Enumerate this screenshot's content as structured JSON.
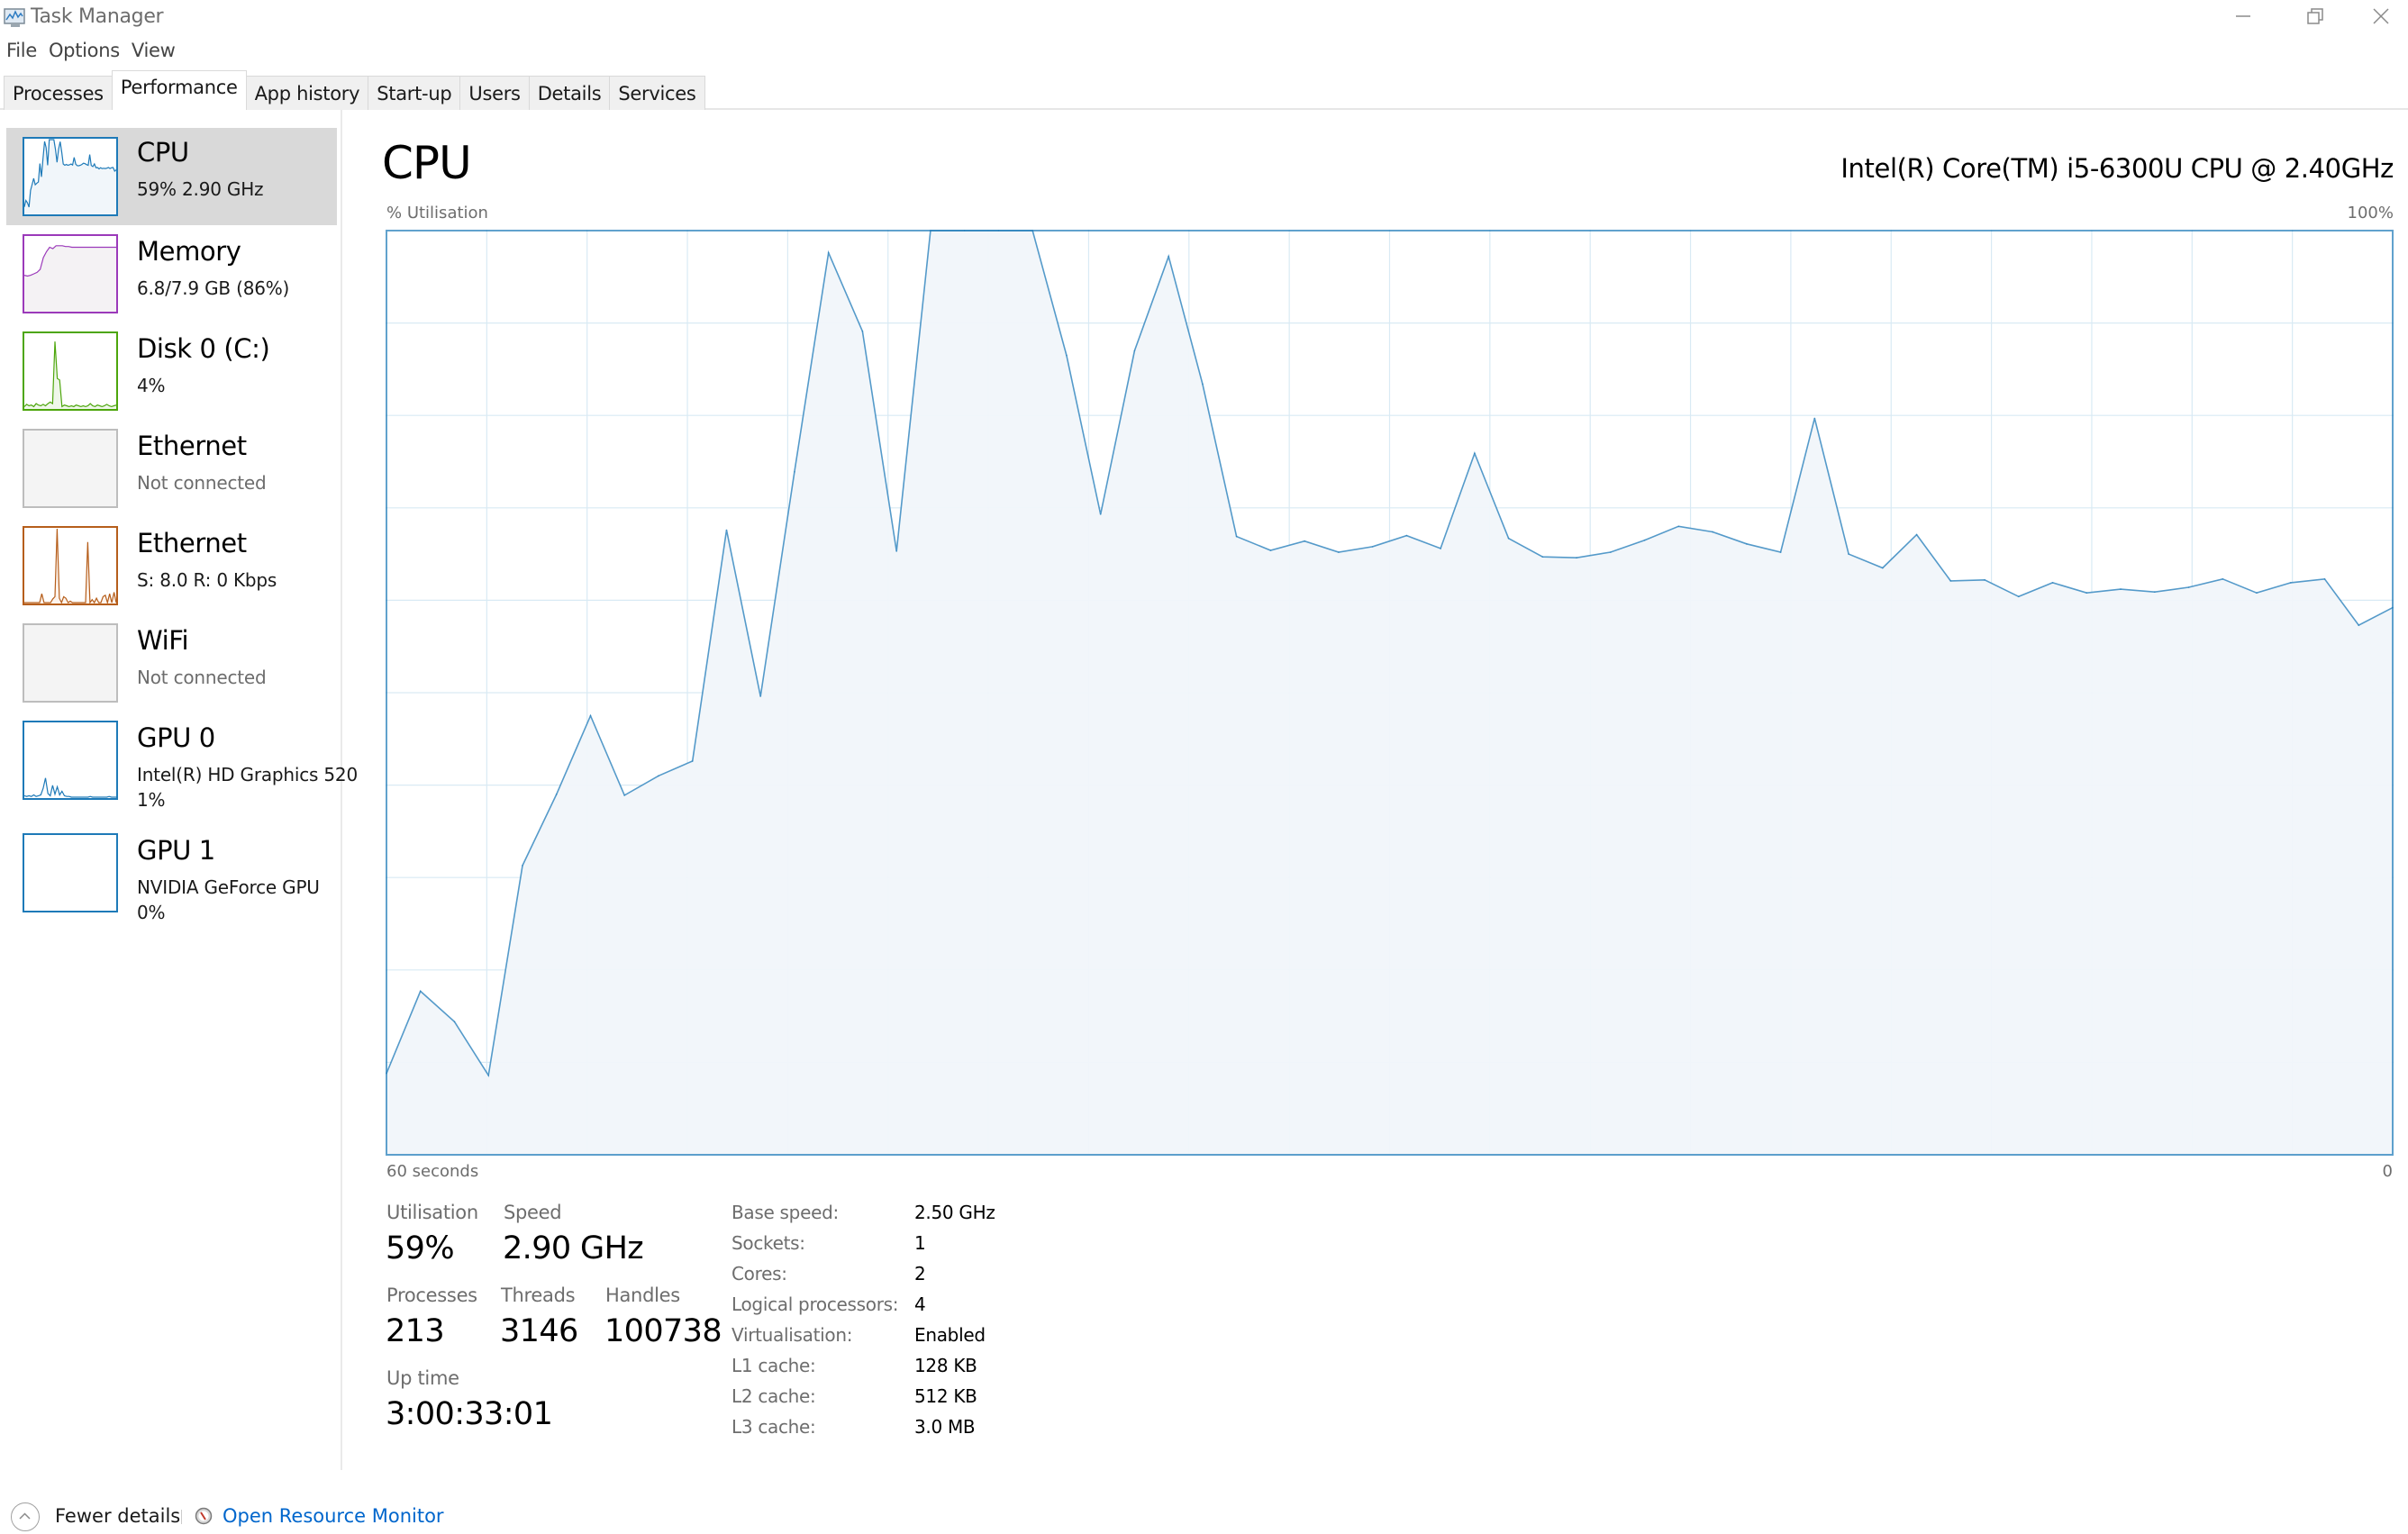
{
  "window": {
    "title": "Task Manager",
    "controls": {
      "minimize": "minimize",
      "restore": "restore",
      "close": "close"
    }
  },
  "menu": [
    "File",
    "Options",
    "View"
  ],
  "tabs": [
    {
      "label": "Processes",
      "active": false
    },
    {
      "label": "Performance",
      "active": true
    },
    {
      "label": "App history",
      "active": false
    },
    {
      "label": "Start-up",
      "active": false
    },
    {
      "label": "Users",
      "active": false
    },
    {
      "label": "Details",
      "active": false
    },
    {
      "label": "Services",
      "active": false
    }
  ],
  "sidebar": {
    "items": [
      {
        "title": "CPU",
        "line1": "59%  2.90 GHz",
        "line2": "",
        "selected": true,
        "color": "#1e7ab8",
        "fill": "#f1f6fa",
        "graph": [
          8.8,
          17.7,
          14.4,
          8.6,
          31.3,
          39,
          47.5,
          38.9,
          41,
          42.6,
          67.6,
          49.6,
          73.9,
          97.6,
          89.1,
          65.3,
          100,
          100,
          100,
          100,
          86.5,
          69.3,
          87,
          97.2,
          83.4,
          66.9,
          65.4,
          66.4,
          65.2,
          65.8,
          67,
          65.6,
          75.9,
          66.7,
          64.7,
          64.6,
          65.2,
          66.5,
          68,
          67.4,
          66.1,
          65.2,
          79.7,
          65,
          63.5,
          67.1,
          62.1,
          62.2,
          60.4,
          61.9,
          60.8,
          61.2,
          60.9,
          61.4,
          62.3,
          60.8,
          61.9,
          62.3,
          57.3,
          59.2
        ]
      },
      {
        "title": "Memory",
        "line1": "6.8/7.9 GB (86%)",
        "line2": "",
        "selected": false,
        "color": "#9b3aba",
        "fill": "#f4f2f4",
        "graph": [
          48,
          47,
          48,
          50,
          52,
          56,
          72,
          80,
          86,
          84,
          88,
          88,
          88,
          87,
          87,
          86,
          86,
          86,
          86,
          86,
          86,
          86,
          86,
          86,
          86,
          86,
          86,
          86,
          86,
          86
        ]
      },
      {
        "title": "Disk 0 (C:)",
        "line1": "4%",
        "line2": "",
        "selected": false,
        "color": "#4da60c",
        "fill": "#eff7ea",
        "graph": [
          2,
          5,
          3,
          4,
          2,
          6,
          4,
          3,
          5,
          3,
          6,
          8,
          6,
          90,
          40,
          38,
          2,
          4,
          3,
          2,
          3,
          2,
          4,
          3,
          2,
          3,
          2,
          3,
          6,
          3,
          2,
          4,
          3,
          2,
          3,
          5,
          3,
          2,
          3,
          4
        ]
      },
      {
        "title": "Ethernet",
        "line1": "Not connected",
        "line2": "",
        "selected": false,
        "disabled": true,
        "color": "#a0a0a0",
        "fill": "#f4f4f4",
        "graph": []
      },
      {
        "title": "Ethernet",
        "line1": "S: 8.0  R: 0 Kbps",
        "line2": "",
        "selected": false,
        "color": "#b65e1b",
        "fill": "#fdf3ec",
        "graph": [
          0,
          0,
          0,
          0,
          0,
          0,
          0,
          0,
          12,
          0,
          0,
          0,
          0,
          5,
          8,
          100,
          6,
          0,
          8,
          6,
          0,
          2,
          0,
          0,
          0,
          0,
          0,
          0,
          0,
          82,
          0,
          4,
          0,
          6,
          0,
          0,
          8,
          10,
          0,
          12,
          0,
          14,
          0
        ]
      },
      {
        "title": "WiFi",
        "line1": "Not connected",
        "line2": "",
        "selected": false,
        "disabled": true,
        "color": "#a0a0a0",
        "fill": "#f4f4f4",
        "graph": []
      },
      {
        "title": "GPU 0",
        "line1": "Intel(R) HD Graphics 520",
        "line2": "1%",
        "selected": false,
        "color": "#1e7ab8",
        "fill": "#ffffff",
        "graph": [
          2,
          1,
          2,
          1,
          3,
          1,
          2,
          3,
          12,
          26,
          5,
          2,
          16,
          4,
          14,
          3,
          8,
          2,
          1,
          1,
          0,
          0,
          0,
          0,
          0,
          0,
          0,
          0,
          1,
          0,
          0,
          0,
          0,
          0,
          0,
          0,
          1,
          0,
          0,
          0
        ]
      },
      {
        "title": "GPU 1",
        "line1": "NVIDIA GeForce GPU",
        "line2": "0%",
        "selected": false,
        "color": "#1e7ab8",
        "fill": "#ffffff",
        "graph": []
      }
    ]
  },
  "main": {
    "title": "CPU",
    "cpu_model": "Intel(R) Core(TM) i5-6300U CPU @ 2.40GHz",
    "axis_y_label": "% Utilisation",
    "axis_y_max": "100%",
    "axis_x_left": "60 seconds",
    "axis_x_right": "0",
    "line_color": "#1e7ab8",
    "fill_color": "#f1f6fa",
    "grid_color": "#d9eaf4",
    "border_color": "#1e7ab8"
  },
  "chart_data": {
    "type": "area",
    "title": "CPU",
    "ylabel": "% Utilisation",
    "xlabel": "",
    "x_range_label": [
      "60 seconds",
      "0"
    ],
    "ylim": [
      0,
      100
    ],
    "grid": true,
    "grid_divisions": {
      "x": 20,
      "y": 10
    },
    "series": [
      {
        "name": "% Utilisation",
        "values": [
          8.8,
          17.7,
          14.4,
          8.6,
          31.3,
          39.0,
          47.5,
          38.9,
          41.0,
          42.6,
          67.6,
          49.6,
          73.9,
          97.6,
          89.1,
          65.3,
          100,
          100,
          100,
          100,
          86.5,
          69.3,
          87.0,
          97.2,
          83.4,
          66.9,
          65.4,
          66.4,
          65.2,
          65.8,
          67.0,
          65.6,
          75.9,
          66.7,
          64.7,
          64.6,
          65.2,
          66.5,
          68.0,
          67.4,
          66.1,
          65.2,
          79.7,
          65.0,
          63.5,
          67.1,
          62.1,
          62.2,
          60.4,
          61.9,
          60.8,
          61.2,
          60.9,
          61.4,
          62.3,
          60.8,
          61.9,
          62.3,
          57.3,
          59.2
        ]
      }
    ]
  },
  "stats": {
    "utilisation": {
      "label": "Utilisation",
      "value": "59%"
    },
    "speed": {
      "label": "Speed",
      "value": "2.90 GHz"
    },
    "processes": {
      "label": "Processes",
      "value": "213"
    },
    "threads": {
      "label": "Threads",
      "value": "3146"
    },
    "handles": {
      "label": "Handles",
      "value": "100738"
    },
    "uptime": {
      "label": "Up time",
      "value": "3:00:33:01"
    }
  },
  "info": [
    {
      "label": "Base speed:",
      "value": "2.50 GHz"
    },
    {
      "label": "Sockets:",
      "value": "1"
    },
    {
      "label": "Cores:",
      "value": "2"
    },
    {
      "label": "Logical processors:",
      "value": "4"
    },
    {
      "label": "Virtualisation:",
      "value": "Enabled"
    },
    {
      "label": "L1 cache:",
      "value": "128 KB"
    },
    {
      "label": "L2 cache:",
      "value": "512 KB"
    },
    {
      "label": "L3 cache:",
      "value": "3.0 MB"
    }
  ],
  "footer": {
    "fewer_details": "Fewer details",
    "open_resource_monitor": "Open Resource Monitor",
    "link_color": "#0066cc"
  }
}
